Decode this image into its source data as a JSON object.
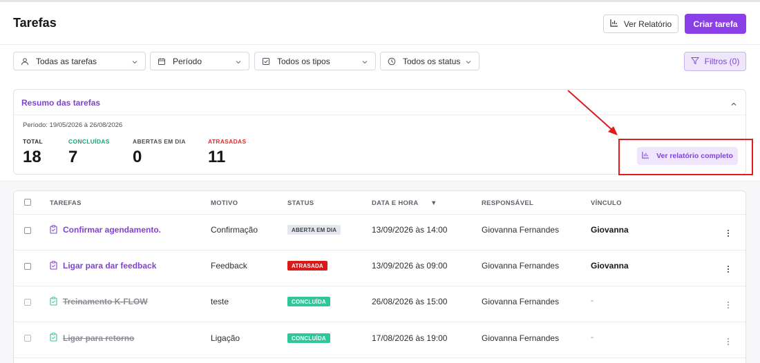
{
  "header": {
    "title": "Tarefas",
    "report_button": "Ver Relatório",
    "create_button": "Criar tarefa"
  },
  "filters": {
    "tasks": "Todas as tarefas",
    "period": "Período",
    "types": "Todos os tipos",
    "status": "Todos os status",
    "filters_button": "Filtros (0)"
  },
  "summary": {
    "title": "Resumo das tarefas",
    "period": "Período: 19/05/2026 à 26/08/2026",
    "stats": [
      {
        "label": "TOTAL",
        "value": "18",
        "color": "#2a2d33"
      },
      {
        "label": "CONCLUÍDAS",
        "value": "7",
        "color": "#16a37a"
      },
      {
        "label": "ABERTAS EM DIA",
        "value": "0",
        "color": "#4a4e56"
      },
      {
        "label": "ATRASADAS",
        "value": "11",
        "color": "#dc2c2c"
      }
    ],
    "full_report_button": "Ver relatório completo"
  },
  "table": {
    "columns": [
      "TAREFAS",
      "MOTIVO",
      "STATUS",
      "DATA E HORA",
      "RESPONSÁVEL",
      "VÍNCULO"
    ],
    "sort_indicator": "▼",
    "rows": [
      {
        "task": "Confirmar agendamento.",
        "reason": "Confirmação",
        "status": "ABERTA EM DIA",
        "datetime": "13/09/2026 às 14:00",
        "owner": "Giovanna Fernandes",
        "link": "Giovanna",
        "done": false
      },
      {
        "task": "Ligar para dar feedback",
        "reason": "Feedback",
        "status": "ATRASADA",
        "datetime": "13/09/2026 às 09:00",
        "owner": "Giovanna Fernandes",
        "link": "Giovanna",
        "done": false
      },
      {
        "task": "Treinamento K-FLOW",
        "reason": "teste",
        "status": "CONCLUÍDA",
        "datetime": "26/08/2026 às 15:00",
        "owner": "Giovanna Fernandes",
        "link": "-",
        "done": true
      },
      {
        "task": "Ligar para retorno",
        "reason": "Ligação",
        "status": "CONCLUÍDA",
        "datetime": "17/08/2026 às 19:00",
        "owner": "Giovanna Fernandes",
        "link": "-",
        "done": true
      }
    ]
  },
  "colors": {
    "accent": "#8b3fe6",
    "open": "#e3e6ec",
    "late": "#d91a1a",
    "done": "#2fc79a",
    "annotation": "#e21a1a"
  }
}
